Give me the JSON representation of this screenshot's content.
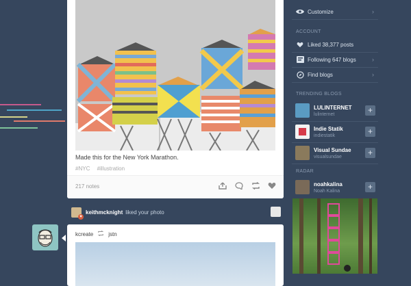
{
  "post": {
    "caption": "Made this for the New York Marathon.",
    "tags": [
      "#NYC",
      "#illustration"
    ],
    "notes": "217 notes"
  },
  "activity": {
    "user": "keithmcknight",
    "text": "liked your photo"
  },
  "post2": {
    "author": "kcreate",
    "reblogged_from": "jstn"
  },
  "sidebar": {
    "customize_label": "Customize",
    "account_header": "ACCOUNT",
    "liked": "Liked 38,377 posts",
    "following": "Following 647 blogs",
    "find_blogs": "Find blogs",
    "trending_header": "TRENDING BLOGS",
    "trending": [
      {
        "name": "LULINTERNET",
        "url": "lulinternet",
        "color": "#5a9bc2"
      },
      {
        "name": "Indie Statik",
        "url": "indiestatik",
        "color": "#d63b4a"
      },
      {
        "name": "Visual Sundae",
        "url": "visualsundae",
        "color": "#8a7a5c"
      }
    ],
    "radar_header": "RADAR",
    "radar": {
      "name": "noahkalina",
      "sub": "Noah Kalina"
    }
  },
  "colors": {
    "background": "#36465d",
    "card": "#ffffff",
    "accent": "#d95e40"
  }
}
